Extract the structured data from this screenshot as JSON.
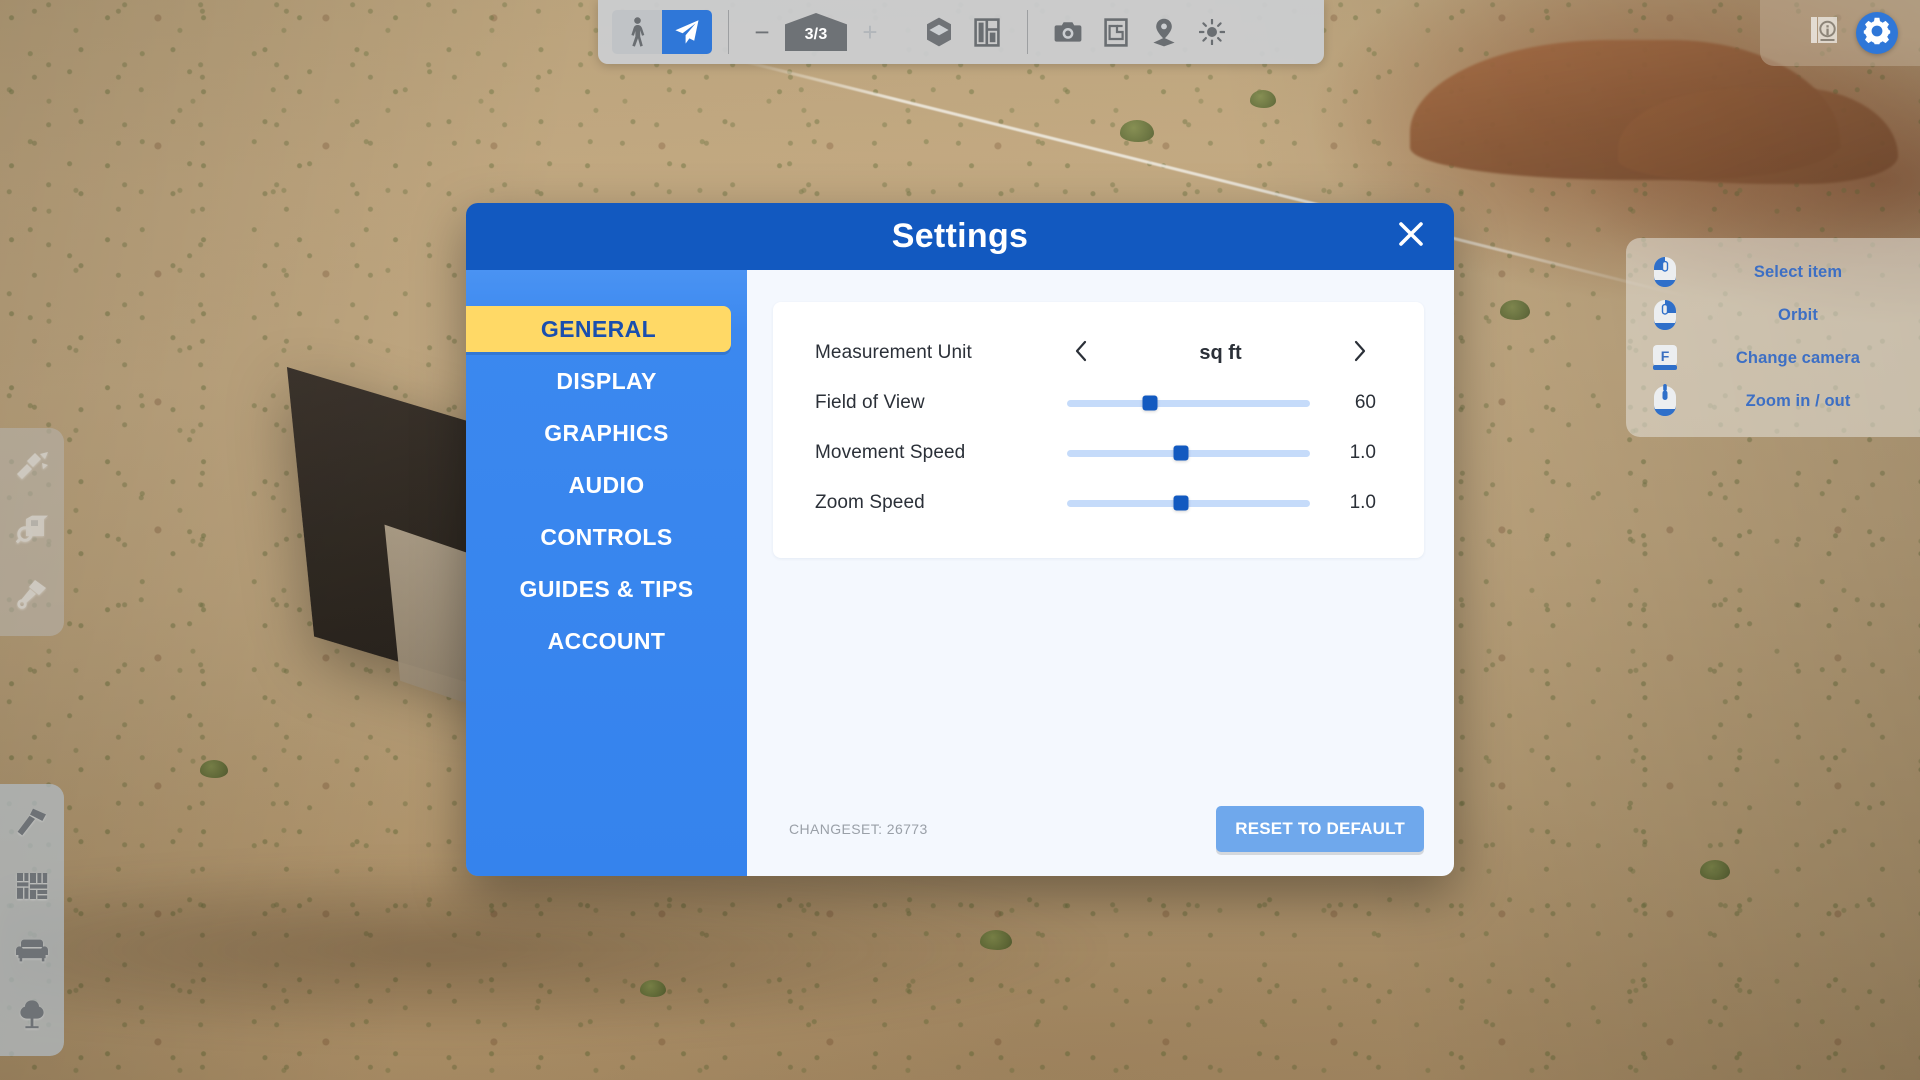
{
  "app": {
    "scene_description": "3d-desert-terrain-viewport"
  },
  "top_toolbar": {
    "walk_mode_icon": "person-walking-icon",
    "fly_mode_icon": "paper-plane-icon",
    "decrease_label": "−",
    "floor_indicator": "3/3",
    "increase_label": "+",
    "view_3d_icon": "cube-layers-icon",
    "floorplan_icon": "floorplan-grid-icon",
    "camera_icon": "camera-icon",
    "export_plan_icon": "export-floorplan-icon",
    "location_icon": "location-pin-icon",
    "sun_icon": "sun-icon"
  },
  "top_right": {
    "info_icon": "info-book-icon",
    "settings_icon": "gear-icon"
  },
  "left_rail_top": {
    "items": [
      {
        "icon": "demolish-hammer-icon",
        "name": "demolish-tool"
      },
      {
        "icon": "inspect-box-icon",
        "name": "inspect-tool"
      },
      {
        "icon": "paint-scraper-icon",
        "name": "scraper-tool"
      }
    ]
  },
  "left_rail_bottom": {
    "items": [
      {
        "icon": "hammer-icon",
        "name": "build-tool"
      },
      {
        "icon": "materials-pattern-icon",
        "name": "materials-tool"
      },
      {
        "icon": "sofa-icon",
        "name": "furniture-tool"
      },
      {
        "icon": "tree-icon",
        "name": "landscape-tool"
      }
    ]
  },
  "help_panel": {
    "rows": [
      {
        "glyph": "mouse-left-click-icon",
        "label": "Select item"
      },
      {
        "glyph": "mouse-right-click-icon",
        "label": "Orbit"
      },
      {
        "glyph": "keyboard-key-f-icon",
        "label": "Change camera",
        "key": "F"
      },
      {
        "glyph": "mouse-scroll-wheel-icon",
        "label": "Zoom in / out"
      }
    ]
  },
  "settings": {
    "title": "Settings",
    "close_icon": "close-icon",
    "sidebar": {
      "items": [
        {
          "label": "GENERAL",
          "active": true
        },
        {
          "label": "DISPLAY",
          "active": false
        },
        {
          "label": "GRAPHICS",
          "active": false
        },
        {
          "label": "AUDIO",
          "active": false
        },
        {
          "label": "CONTROLS",
          "active": false
        },
        {
          "label": "GUIDES & TIPS",
          "active": false
        },
        {
          "label": "ACCOUNT",
          "active": false
        }
      ]
    },
    "rows": [
      {
        "label": "Measurement Unit",
        "type": "stepper",
        "value": "sq ft",
        "prev_icon": "chevron-left-icon",
        "next_icon": "chevron-right-icon"
      },
      {
        "label": "Field of View",
        "type": "slider",
        "value": "60",
        "percent": 34
      },
      {
        "label": "Movement Speed",
        "type": "slider",
        "value": "1.0",
        "percent": 47
      },
      {
        "label": "Zoom Speed",
        "type": "slider",
        "value": "1.0",
        "percent": 47
      }
    ],
    "changeset": "CHANGESET: 26773",
    "reset_label": "RESET TO DEFAULT"
  },
  "colors": {
    "header_blue": "#1259c0",
    "sidebar_blue": "#3b88ef",
    "active_yellow": "#ffd966",
    "accent_blue": "#2f77d8",
    "slider_track": "#c5dbfa",
    "reset_button": "#6fa8ec"
  }
}
